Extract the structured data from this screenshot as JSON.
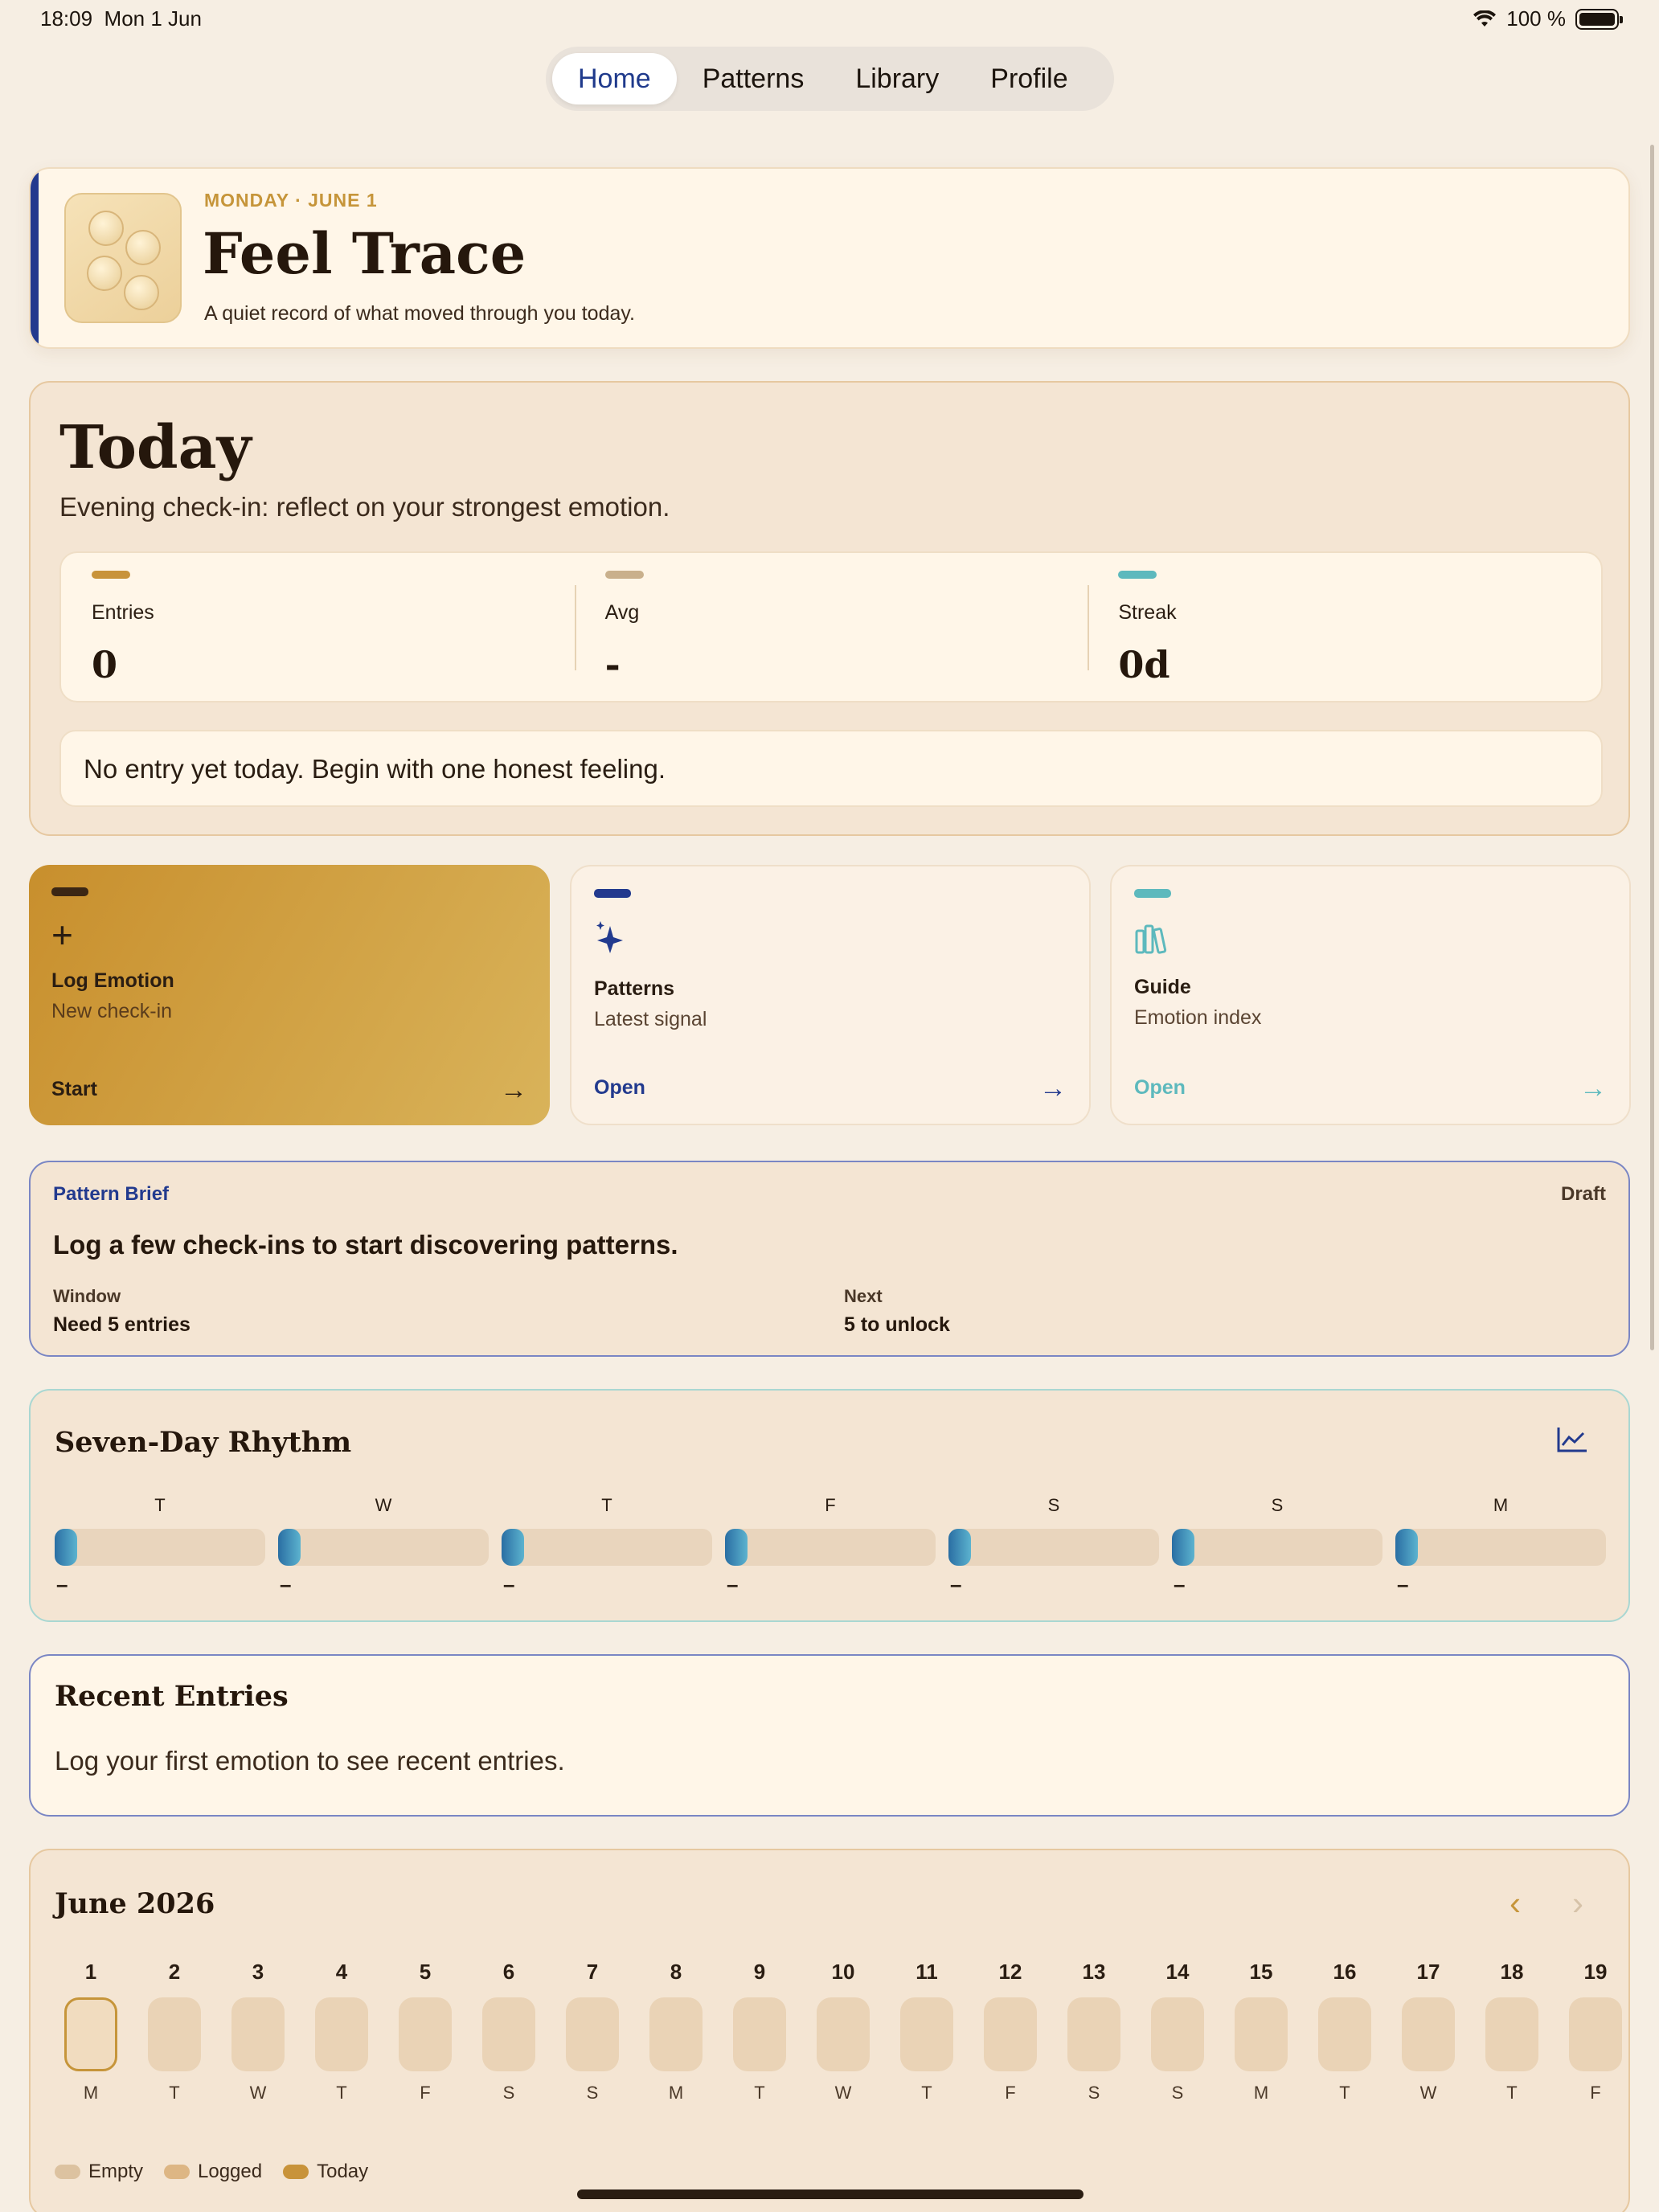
{
  "status_bar": {
    "time": "18:09",
    "date": "Mon 1 Jun",
    "battery": "100 %"
  },
  "tabs": [
    {
      "label": "Home",
      "active": true
    },
    {
      "label": "Patterns",
      "active": false
    },
    {
      "label": "Library",
      "active": false
    },
    {
      "label": "Profile",
      "active": false
    }
  ],
  "header": {
    "date": "MONDAY · JUNE 1",
    "title": "Feel Trace",
    "subtitle": "A quiet record of what moved through you today."
  },
  "today": {
    "title": "Today",
    "subtitle": "Evening check-in: reflect on your strongest emotion.",
    "stats": [
      {
        "label": "Entries",
        "value": "0",
        "color": "#c8933a"
      },
      {
        "label": "Avg",
        "value": "-",
        "color": "#c9b08c"
      },
      {
        "label": "Streak",
        "value": "0d",
        "color": "#5db9bd"
      }
    ],
    "notice": "No entry yet today. Begin with one honest feeling."
  },
  "actions": [
    {
      "title": "Log Emotion",
      "subtitle": "New check-in",
      "cta": "Start",
      "icon": "plus-icon",
      "accent": "#3b2614"
    },
    {
      "title": "Patterns",
      "subtitle": "Latest signal",
      "cta": "Open",
      "icon": "sparkles-icon",
      "accent": "#223a8e"
    },
    {
      "title": "Guide",
      "subtitle": "Emotion index",
      "cta": "Open",
      "icon": "books-icon",
      "accent": "#5db9bd"
    }
  ],
  "pattern_brief": {
    "label": "Pattern Brief",
    "status": "Draft",
    "message": "Log a few check-ins to start discovering patterns.",
    "window_label": "Window",
    "window_value": "Need 5 entries",
    "next_label": "Next",
    "next_value": "5 to unlock"
  },
  "rhythm": {
    "title": "Seven-Day Rhythm",
    "icon": "line-chart-icon",
    "days": [
      {
        "letter": "T",
        "value": "–"
      },
      {
        "letter": "W",
        "value": "–"
      },
      {
        "letter": "T",
        "value": "–"
      },
      {
        "letter": "F",
        "value": "–"
      },
      {
        "letter": "S",
        "value": "–"
      },
      {
        "letter": "S",
        "value": "–"
      },
      {
        "letter": "M",
        "value": "–"
      }
    ]
  },
  "recent": {
    "title": "Recent Entries",
    "message": "Log your first emotion to see recent entries."
  },
  "calendar": {
    "title": "June 2026",
    "days": [
      {
        "num": "1",
        "wd": "M",
        "today": true
      },
      {
        "num": "2",
        "wd": "T"
      },
      {
        "num": "3",
        "wd": "W"
      },
      {
        "num": "4",
        "wd": "T"
      },
      {
        "num": "5",
        "wd": "F"
      },
      {
        "num": "6",
        "wd": "S"
      },
      {
        "num": "7",
        "wd": "S"
      },
      {
        "num": "8",
        "wd": "M"
      },
      {
        "num": "9",
        "wd": "T"
      },
      {
        "num": "10",
        "wd": "W"
      },
      {
        "num": "11",
        "wd": "T"
      },
      {
        "num": "12",
        "wd": "F"
      },
      {
        "num": "13",
        "wd": "S"
      },
      {
        "num": "14",
        "wd": "S"
      },
      {
        "num": "15",
        "wd": "M"
      },
      {
        "num": "16",
        "wd": "T"
      },
      {
        "num": "17",
        "wd": "W"
      },
      {
        "num": "18",
        "wd": "T"
      },
      {
        "num": "19",
        "wd": "F"
      }
    ],
    "legend": [
      {
        "label": "Empty",
        "color": "#dcc2a0"
      },
      {
        "label": "Logged",
        "color": "#ddb684"
      },
      {
        "label": "Today",
        "color": "#c8933a"
      }
    ]
  }
}
